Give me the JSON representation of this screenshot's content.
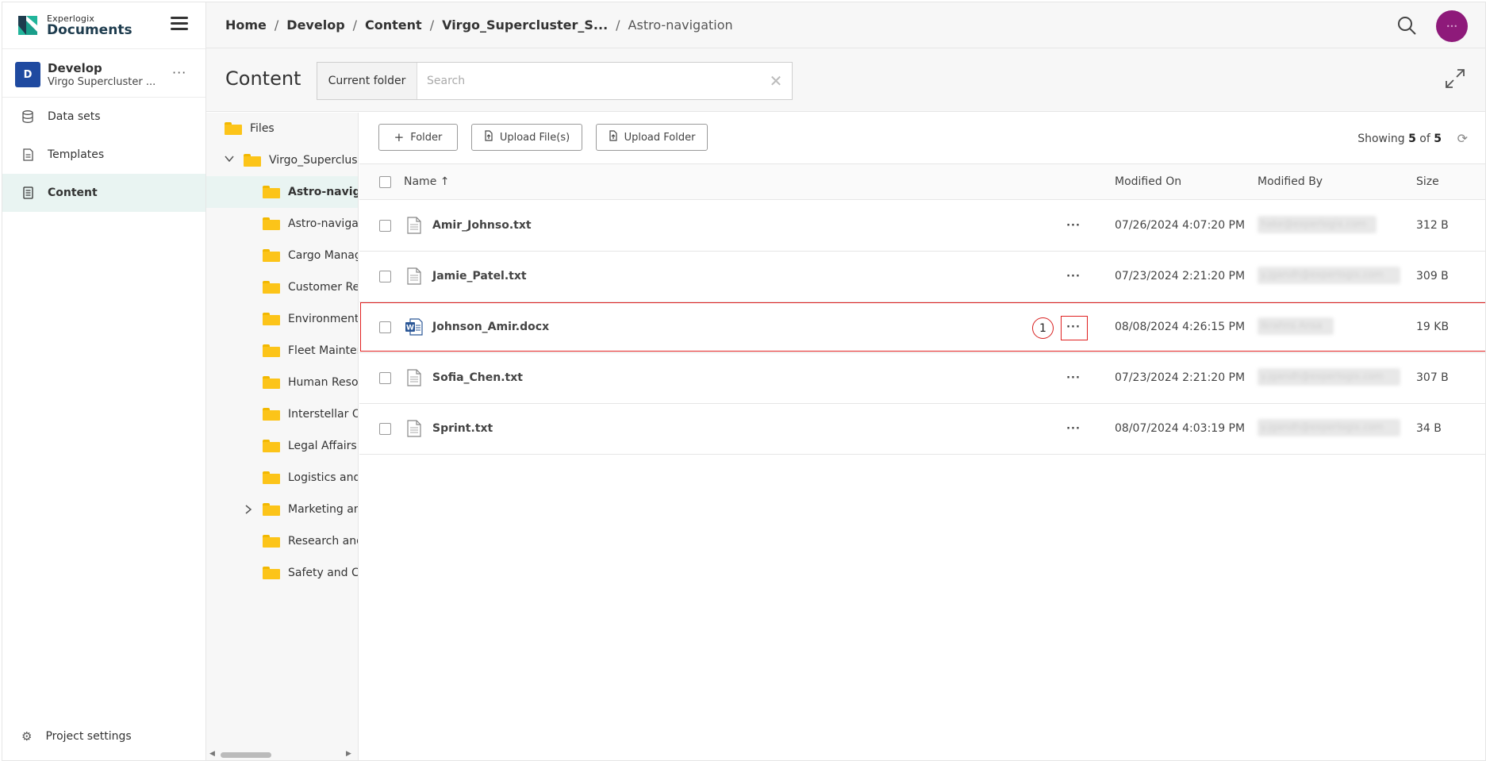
{
  "app": {
    "brand_small": "Experlogix",
    "brand_big": "Documents"
  },
  "project": {
    "initial": "D",
    "name": "Develop",
    "subtitle": "Virgo Supercluster ...",
    "more": "···"
  },
  "nav": [
    {
      "label": "Data sets",
      "icon": "database-icon"
    },
    {
      "label": "Templates",
      "icon": "template-icon"
    },
    {
      "label": "Content",
      "icon": "content-icon",
      "active": true
    }
  ],
  "settings": {
    "label": "Project settings",
    "icon": "gear-icon"
  },
  "breadcrumb": [
    {
      "label": "Home"
    },
    {
      "label": "Develop"
    },
    {
      "label": "Content"
    },
    {
      "label": "Virgo_Supercluster_S..."
    },
    {
      "label": "Astro-navigation",
      "current": true
    }
  ],
  "user": {
    "avatar_text": "•••"
  },
  "content_header": {
    "title": "Content",
    "scope_label": "Current folder",
    "search_placeholder": "Search",
    "search_value": ""
  },
  "tree": {
    "root": "Files",
    "parent": "Virgo_Supercluster_S",
    "items": [
      {
        "label": "Astro-navigation",
        "selected": true
      },
      {
        "label": "Astro-navigation"
      },
      {
        "label": "Cargo Management"
      },
      {
        "label": "Customer Relations"
      },
      {
        "label": "Environmental"
      },
      {
        "label": "Fleet Maintenance"
      },
      {
        "label": "Human Resources"
      },
      {
        "label": "Interstellar Operations"
      },
      {
        "label": "Legal Affairs"
      },
      {
        "label": "Logistics and"
      },
      {
        "label": "Marketing and",
        "expandable": true
      },
      {
        "label": "Research and"
      },
      {
        "label": "Safety and Compliance"
      }
    ]
  },
  "toolbar": {
    "folder_label": "Folder",
    "upload_files_label": "Upload File(s)",
    "upload_folder_label": "Upload Folder",
    "showing_prefix": "Showing",
    "showing_count": "5",
    "showing_of": "of",
    "showing_total": "5"
  },
  "table": {
    "columns": {
      "name": "Name ↑",
      "modified_on": "Modified On",
      "modified_by": "Modified By",
      "size": "Size"
    },
    "rows": [
      {
        "name": "Amir_Johnso.txt",
        "type": "txt",
        "modified_on": "07/26/2024 4:07:20 PM",
        "modified_by": "hake@experlogix.com",
        "size": "312 B"
      },
      {
        "name": "Jamie_Patel.txt",
        "type": "txt",
        "modified_on": "07/23/2024 2:21:20 PM",
        "modified_by": "y.jgandh@experlogix.com",
        "size": "309 B"
      },
      {
        "name": "Johnson_Amir.docx",
        "type": "docx",
        "modified_on": "08/08/2024 4:26:15 PM",
        "modified_by": "Ikrahns Ansa",
        "size": "19 KB"
      },
      {
        "name": "Sofia_Chen.txt",
        "type": "txt",
        "modified_on": "07/23/2024 2:21:20 PM",
        "modified_by": "y.jgandh@experlogix.com",
        "size": "307 B"
      },
      {
        "name": "Sprint.txt",
        "type": "txt",
        "modified_on": "08/07/2024 4:03:19 PM",
        "modified_by": "y.jgandh@experlogix.com",
        "size": "34 B"
      }
    ]
  },
  "annotation": {
    "step": "1"
  },
  "colors": {
    "accent_teal": "#1a9e8a",
    "active_bg": "#e9f4f2",
    "highlight_red": "#e02020",
    "folder_yellow": "#fcc419",
    "avatar_purple": "#8e1a7a",
    "project_blue": "#1f4aa0"
  }
}
